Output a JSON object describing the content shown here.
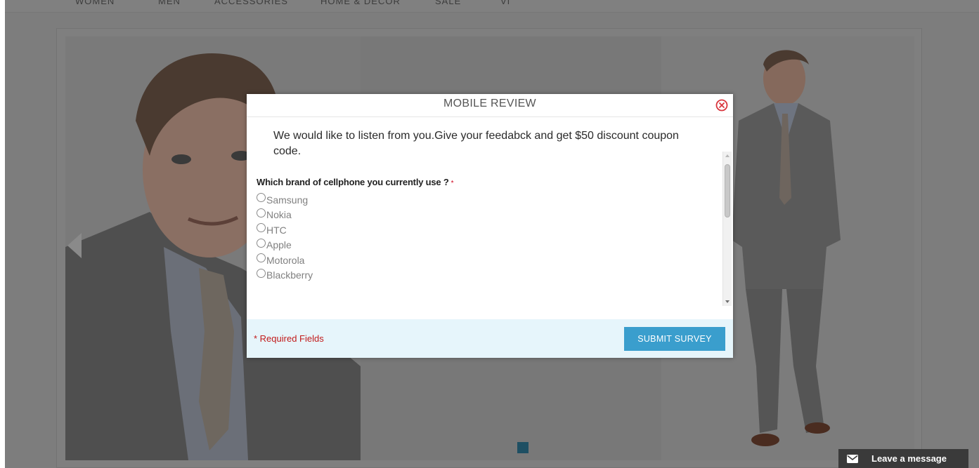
{
  "nav": {
    "items": [
      "WOMEN",
      "MEN",
      "ACCESSORIES",
      "HOME & DECOR",
      "SALE",
      "VI"
    ]
  },
  "modal": {
    "title": "MOBILE REVIEW",
    "intro": "We would like to listen from you.Give your feedabck and get $50 discount coupon code.",
    "question": "Which brand of cellphone you currently use ?",
    "required_marker": "*",
    "options": [
      "Samsung",
      "Nokia",
      "HTC",
      "Apple",
      "Motorola",
      "Blackberry"
    ],
    "required_note": "* Required Fields",
    "submit_label": "SUBMIT SURVEY"
  },
  "chat": {
    "label": "Leave a message"
  },
  "colors": {
    "overlay": "#7d7d7d",
    "accent": "#3a9ecd",
    "footer_bg": "#e6f5fb",
    "required": "#c21a1a",
    "slider_dot": "#1e4f63",
    "close_icon": "#d9363e"
  },
  "icons": {
    "close": "close-circle-icon",
    "chat": "envelope-icon"
  }
}
